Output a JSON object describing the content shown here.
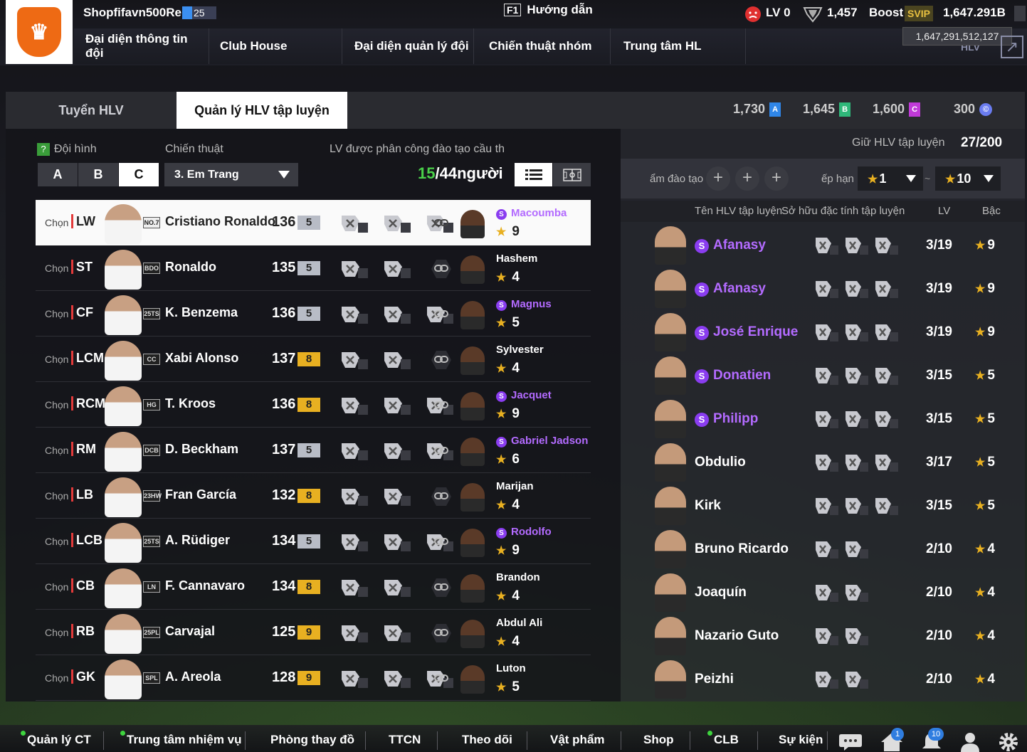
{
  "user": {
    "name": "Shopfifavn500Re",
    "level": "25"
  },
  "nav": {
    "items": [
      "Đại diện thông tin đội",
      "Club House",
      "Đại diện quản lý đội",
      "Chiến thuật nhóm",
      "Trung tâm HL"
    ],
    "hidden_last": "HLV"
  },
  "guide": {
    "key": "F1",
    "label": "Hướng dẫn"
  },
  "resources": {
    "lv": "LV 0",
    "shield": "1,457",
    "boost": "Boost",
    "svip": "SVIP",
    "bp": "1,647.291B",
    "tooltip": "1,647,291,512,127"
  },
  "tabs": {
    "recruit": "Tuyển HLV",
    "manage": "Quản lý HLV tập luyện"
  },
  "currency": [
    {
      "value": "1,730",
      "badge": "A",
      "color": "#2f86e8"
    },
    {
      "value": "1,645",
      "badge": "B",
      "color": "#2fb87a"
    },
    {
      "value": "1,600",
      "badge": "C",
      "color": "#c03ad8"
    },
    {
      "value": "300",
      "badge": "©",
      "color": "#6a7cf0"
    }
  ],
  "left": {
    "formation_label": "Đội hình",
    "formation_options": [
      "A",
      "B",
      "C"
    ],
    "formation_selected": "C",
    "tactic_label": "Chiến thuật",
    "tactic_value": "3. Em Trang",
    "assign_label": "LV được phân công đào tạo cầu th",
    "count_current": "15",
    "count_total": "/44người"
  },
  "rows": [
    {
      "chon": "Chọn",
      "pos": "LW",
      "season": "NO.7",
      "name": "Cristiano Ronaldo",
      "ovr": "136",
      "lvl": "5",
      "lvl_color": "#b8bcc6",
      "traits": 3,
      "coach": "Macoumba",
      "coach_s": true,
      "coach_stars": "9",
      "selected": true
    },
    {
      "chon": "Chọn",
      "pos": "ST",
      "season": "BDO",
      "name": "Ronaldo",
      "ovr": "135",
      "lvl": "5",
      "lvl_color": "#b8bcc6",
      "traits": 2,
      "coach": "Hashem",
      "coach_s": false,
      "coach_stars": "4",
      "selected": false
    },
    {
      "chon": "Chọn",
      "pos": "CF",
      "season": "25TS",
      "name": "K. Benzema",
      "ovr": "136",
      "lvl": "5",
      "lvl_color": "#b8bcc6",
      "traits": 3,
      "coach": "Magnus",
      "coach_s": true,
      "coach_stars": "5",
      "selected": false
    },
    {
      "chon": "Chọn",
      "pos": "LCM",
      "season": "CC",
      "name": "Xabi Alonso",
      "ovr": "137",
      "lvl": "8",
      "lvl_color": "#e8b021",
      "traits": 2,
      "coach": "Sylvester",
      "coach_s": false,
      "coach_stars": "4",
      "selected": false
    },
    {
      "chon": "Chọn",
      "pos": "RCM",
      "season": "HG",
      "name": "T. Kroos",
      "ovr": "136",
      "lvl": "8",
      "lvl_color": "#e8b021",
      "traits": 3,
      "coach": "Jacquet",
      "coach_s": true,
      "coach_stars": "9",
      "selected": false
    },
    {
      "chon": "Chọn",
      "pos": "RM",
      "season": "DCB",
      "name": "D. Beckham",
      "ovr": "137",
      "lvl": "5",
      "lvl_color": "#b8bcc6",
      "traits": 3,
      "coach": "Gabriel Jadson",
      "coach_s": true,
      "coach_stars": "6",
      "selected": false
    },
    {
      "chon": "Chọn",
      "pos": "LB",
      "season": "23HW",
      "name": "Fran García",
      "ovr": "132",
      "lvl": "8",
      "lvl_color": "#e8b021",
      "traits": 2,
      "coach": "Marijan",
      "coach_s": false,
      "coach_stars": "4",
      "selected": false
    },
    {
      "chon": "Chọn",
      "pos": "LCB",
      "season": "25TS",
      "name": "A. Rüdiger",
      "ovr": "134",
      "lvl": "5",
      "lvl_color": "#b8bcc6",
      "traits": 3,
      "coach": "Rodolfo",
      "coach_s": true,
      "coach_stars": "9",
      "selected": false
    },
    {
      "chon": "Chọn",
      "pos": "CB",
      "season": "LN",
      "name": "F. Cannavaro",
      "ovr": "134",
      "lvl": "8",
      "lvl_color": "#e8b021",
      "traits": 2,
      "coach": "Brandon",
      "coach_s": false,
      "coach_stars": "4",
      "selected": false
    },
    {
      "chon": "Chọn",
      "pos": "RB",
      "season": "25PL",
      "name": "Carvajal",
      "ovr": "125",
      "lvl": "9",
      "lvl_color": "#e8b021",
      "traits": 2,
      "coach": "Abdul Ali",
      "coach_s": false,
      "coach_stars": "4",
      "selected": false
    },
    {
      "chon": "Chọn",
      "pos": "GK",
      "season": "SPL",
      "name": "A. Areola",
      "ovr": "128",
      "lvl": "9",
      "lvl_color": "#e8b021",
      "traits": 3,
      "coach": "Luton",
      "coach_s": false,
      "coach_stars": "5",
      "selected": false
    }
  ],
  "right": {
    "keep_label": "Giữ HLV tập luyện",
    "keep_value": "27/200",
    "filter_label": "ẩm đào tạo",
    "rank_label": "ếp hạn",
    "rank_from": "1",
    "rank_sep": "~",
    "rank_to": "10",
    "col_name": "Tên HLV tập luyện",
    "col_trait": "Sở hữu đặc tính tập luyện",
    "col_lv": "LV",
    "col_rank": "Bậc"
  },
  "coaches": [
    {
      "name": "Afanasy",
      "s": true,
      "traits": 3,
      "lv": "3/19",
      "stars": "9"
    },
    {
      "name": "Afanasy",
      "s": true,
      "traits": 3,
      "lv": "3/19",
      "stars": "9"
    },
    {
      "name": "José Enrique",
      "s": true,
      "traits": 3,
      "lv": "3/19",
      "stars": "9"
    },
    {
      "name": "Donatien",
      "s": true,
      "traits": 3,
      "lv": "3/15",
      "stars": "5"
    },
    {
      "name": "Philipp",
      "s": true,
      "traits": 3,
      "lv": "3/15",
      "stars": "5"
    },
    {
      "name": "Obdulio",
      "s": false,
      "traits": 3,
      "lv": "3/17",
      "stars": "5"
    },
    {
      "name": "Kirk",
      "s": false,
      "traits": 3,
      "lv": "3/15",
      "stars": "5"
    },
    {
      "name": "Bruno Ricardo",
      "s": false,
      "traits": 2,
      "lv": "2/10",
      "stars": "4"
    },
    {
      "name": "Joaquín",
      "s": false,
      "traits": 2,
      "lv": "2/10",
      "stars": "4"
    },
    {
      "name": "Nazario Guto",
      "s": false,
      "traits": 2,
      "lv": "2/10",
      "stars": "4"
    },
    {
      "name": "Peizhi",
      "s": false,
      "traits": 2,
      "lv": "2/10",
      "stars": "4"
    }
  ],
  "bottom": {
    "items": [
      "Quản lý CT",
      "Trung tâm nhiệm vụ",
      "Phòng thay đồ",
      "TTCN",
      "Theo dõi",
      "Vật phẩm",
      "Shop",
      "CLB",
      "Sự kiện"
    ],
    "badge_home": "1",
    "badge_bell": "10"
  }
}
